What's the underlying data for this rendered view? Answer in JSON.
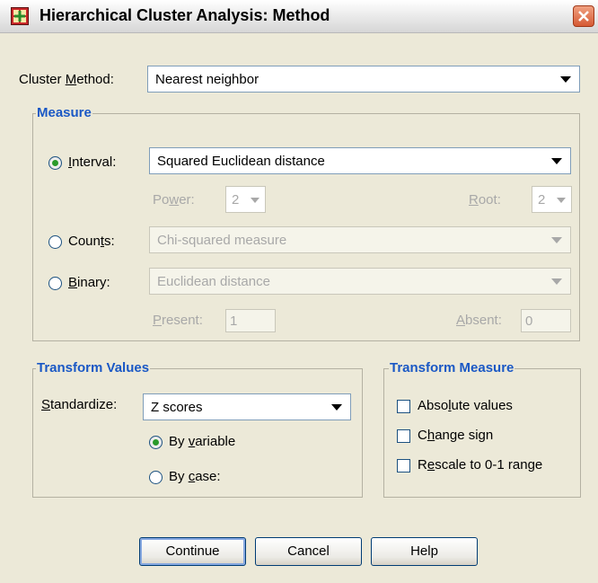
{
  "window": {
    "title": "Hierarchical Cluster Analysis: Method"
  },
  "cluster_method": {
    "label_pre": "Cluster ",
    "label_mn": "M",
    "label_post": "ethod:",
    "value": "Nearest neighbor"
  },
  "measure": {
    "group_title": "Measure",
    "interval": {
      "label_pre": "",
      "label_mn": "I",
      "label_post": "nterval:",
      "value": "Squared Euclidean distance",
      "selected": true
    },
    "power": {
      "label_pre": "Po",
      "label_mn": "w",
      "label_post": "er:",
      "value": "2"
    },
    "root": {
      "label_pre": "",
      "label_mn": "R",
      "label_post": "oot:",
      "value": "2"
    },
    "counts": {
      "label_pre": "Coun",
      "label_mn": "t",
      "label_post": "s:",
      "value": "Chi-squared measure",
      "selected": false
    },
    "binary": {
      "label_pre": "",
      "label_mn": "B",
      "label_post": "inary:",
      "value": "Euclidean distance",
      "selected": false
    },
    "present": {
      "label_pre": "",
      "label_mn": "P",
      "label_post": "resent:",
      "value": "1"
    },
    "absent": {
      "label_pre": "",
      "label_mn": "A",
      "label_post": "bsent:",
      "value": "0"
    }
  },
  "transform_values": {
    "group_title": "Transform Values",
    "standardize": {
      "label_pre": "",
      "label_mn": "S",
      "label_post": "tandardize:",
      "value": "Z scores"
    },
    "by_variable": {
      "label_pre": "By ",
      "label_mn": "v",
      "label_post": "ariable",
      "selected": true
    },
    "by_case": {
      "label_pre": "By ",
      "label_mn": "c",
      "label_post": "ase:",
      "selected": false
    }
  },
  "transform_measure": {
    "group_title": "Transform Measure",
    "absolute": {
      "label_pre": "Abso",
      "label_mn": "l",
      "label_post": "ute values",
      "checked": false
    },
    "change_sign": {
      "label_pre": "C",
      "label_mn": "h",
      "label_post": "ange sign",
      "checked": false
    },
    "rescale": {
      "label_pre": "R",
      "label_mn": "e",
      "label_post": "scale to 0-1 range",
      "checked": false
    }
  },
  "buttons": {
    "continue": "Continue",
    "cancel": "Cancel",
    "help": "Help"
  },
  "colors": {
    "group_title": "#1A58C5",
    "dialog_bg": "#ECE9D8",
    "disabled_text": "#A8A8A8"
  }
}
